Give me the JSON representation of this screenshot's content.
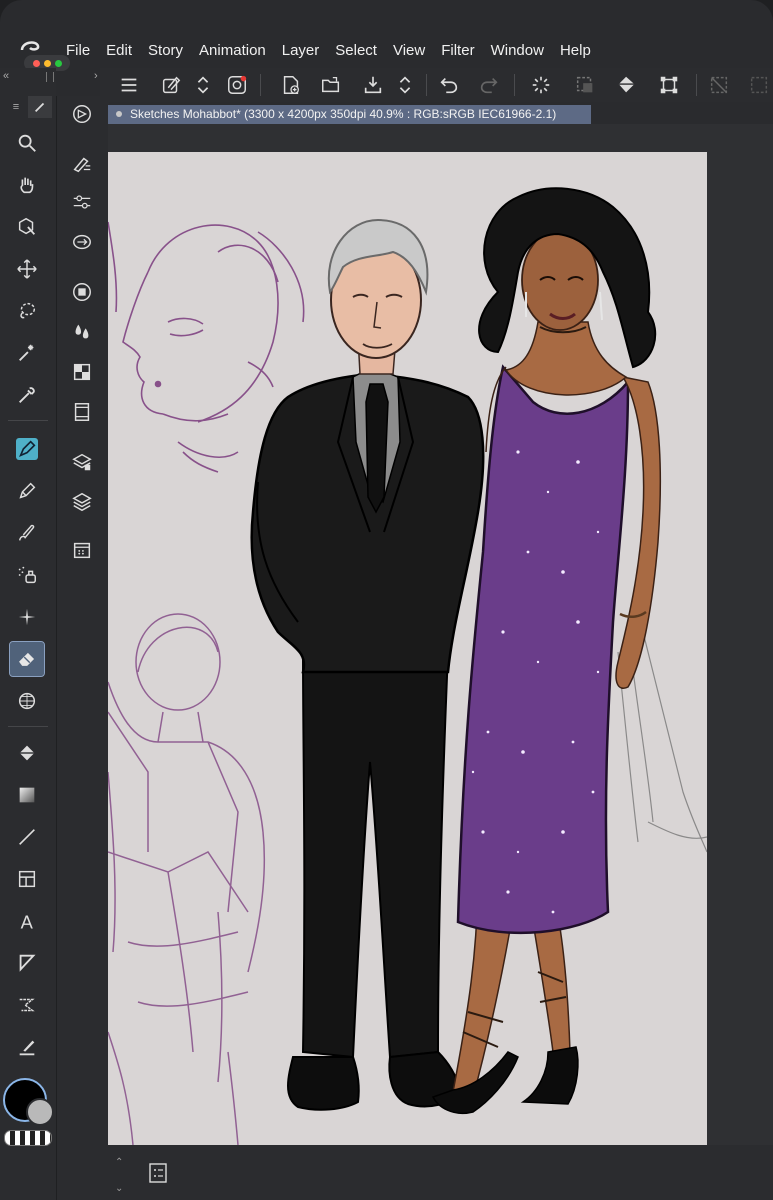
{
  "menu": {
    "items": [
      "File",
      "Edit",
      "Story",
      "Animation",
      "Layer",
      "Select",
      "View",
      "Filter",
      "Window",
      "Help"
    ]
  },
  "document": {
    "tab_title": "Sketches Mohabbot* (3300 x 4200px 350dpi 40.9% : RGB:sRGB IEC61966-2.1)"
  },
  "toolbar": {
    "buttons": [
      "menu-icon",
      "edit-layer-icon",
      "switch-arrows-icon",
      "companion-icon",
      "new-canvas-icon",
      "open-folder-icon",
      "save-icon",
      "save-arrows-icon",
      "undo-icon",
      "redo-icon",
      "loading-icon",
      "select-all-icon",
      "fill-icon",
      "transform-icon",
      "clear-selection-icon"
    ]
  },
  "left_tools": [
    "zoom-icon",
    "hand-icon",
    "object-select-icon",
    "move-icon",
    "lasso-icon",
    "magic-wand-icon",
    "eyedropper-icon",
    "pen-icon",
    "pencil-icon",
    "brush-icon",
    "airbrush-icon",
    "decoration-icon",
    "eraser-icon",
    "blend-icon",
    "fill-bucket-icon",
    "gradient-icon",
    "line-icon",
    "frame-icon",
    "text-icon",
    "balloon-icon",
    "ruler-icon",
    "correct-line-icon"
  ],
  "sub_tools": [
    "navigator-icon",
    "tool-property-icon",
    "brush-size-icon",
    "color-set-icon",
    "color-wheel-icon",
    "color-mix-icon",
    "material-icon",
    "timeline-icon",
    "layer-property-icon",
    "layers-icon",
    "animation-icon"
  ],
  "colors": {
    "main": "#000000",
    "sub": "#b9b9b9",
    "accent": "#5d6a85",
    "canvas": "#d9d5d5",
    "sketch_purple": "#7a3b7e",
    "dress_purple": "#6a3d8a"
  }
}
